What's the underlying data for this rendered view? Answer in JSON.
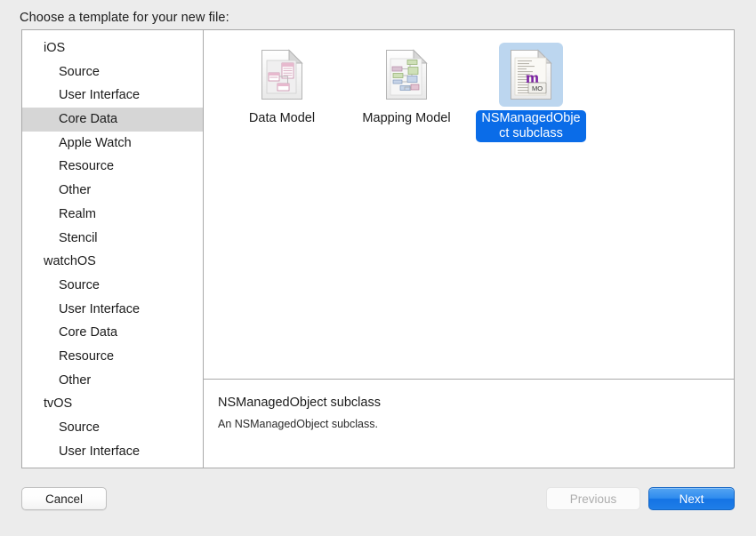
{
  "header": {
    "title": "Choose a template for your new file:"
  },
  "sidebar": {
    "groups": [
      {
        "name": "iOS",
        "items": [
          {
            "label": "Source",
            "selected": false
          },
          {
            "label": "User Interface",
            "selected": false
          },
          {
            "label": "Core Data",
            "selected": true
          },
          {
            "label": "Apple Watch",
            "selected": false
          },
          {
            "label": "Resource",
            "selected": false
          },
          {
            "label": "Other",
            "selected": false
          },
          {
            "label": "Realm",
            "selected": false
          },
          {
            "label": "Stencil",
            "selected": false
          }
        ]
      },
      {
        "name": "watchOS",
        "items": [
          {
            "label": "Source",
            "selected": false
          },
          {
            "label": "User Interface",
            "selected": false
          },
          {
            "label": "Core Data",
            "selected": false
          },
          {
            "label": "Resource",
            "selected": false
          },
          {
            "label": "Other",
            "selected": false
          }
        ]
      },
      {
        "name": "tvOS",
        "items": [
          {
            "label": "Source",
            "selected": false
          },
          {
            "label": "User Interface",
            "selected": false
          }
        ]
      }
    ]
  },
  "templates": [
    {
      "label": "Data Model",
      "icon": "data-model-icon",
      "selected": false
    },
    {
      "label": "Mapping Model",
      "icon": "mapping-model-icon",
      "selected": false
    },
    {
      "label": "NSManagedObject subclass",
      "icon": "nsmanagedobject-subclass-icon",
      "selected": true
    }
  ],
  "description": {
    "title": "NSManagedObject subclass",
    "body": "An NSManagedObject subclass."
  },
  "footer": {
    "cancel_label": "Cancel",
    "previous_label": "Previous",
    "next_label": "Next"
  },
  "colors": {
    "window_background": "#ececec",
    "panel_background": "#ffffff",
    "panel_border": "#a9a9a9",
    "sidebar_selection": "#d6d6d6",
    "template_selection_tint": "#bcd6ef",
    "template_label_selection": "#0a6ce8",
    "default_button_blue": "#1473e4",
    "disabled_text": "#adadad"
  }
}
